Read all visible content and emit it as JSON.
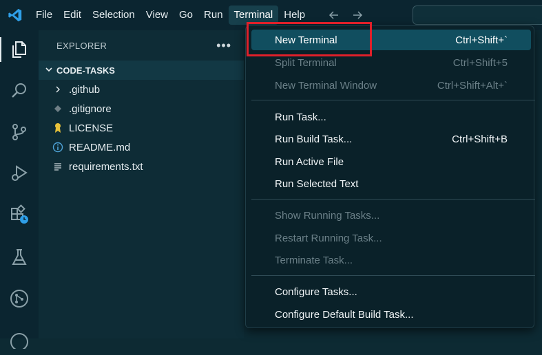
{
  "menubar": {
    "items": [
      {
        "label": "File"
      },
      {
        "label": "Edit"
      },
      {
        "label": "Selection"
      },
      {
        "label": "View"
      },
      {
        "label": "Go"
      },
      {
        "label": "Run"
      },
      {
        "label": "Terminal"
      },
      {
        "label": "Help"
      }
    ],
    "active": "Terminal"
  },
  "sidebar": {
    "title": "EXPLORER",
    "more": "•••",
    "folder": {
      "name": "CODE-TASKS",
      "expanded": true
    },
    "files": [
      {
        "name": ".github",
        "icon": "chevron-right-icon"
      },
      {
        "name": ".gitignore",
        "icon": "git-icon"
      },
      {
        "name": "LICENSE",
        "icon": "license-icon"
      },
      {
        "name": "README.md",
        "icon": "info-icon"
      },
      {
        "name": "requirements.txt",
        "icon": "text-file-icon"
      }
    ]
  },
  "terminal_menu": {
    "groups": [
      [
        {
          "label": "New Terminal",
          "shortcut": "Ctrl+Shift+`",
          "enabled": true,
          "highlighted": true
        },
        {
          "label": "Split Terminal",
          "shortcut": "Ctrl+Shift+5",
          "enabled": false
        },
        {
          "label": "New Terminal Window",
          "shortcut": "Ctrl+Shift+Alt+`",
          "enabled": false
        }
      ],
      [
        {
          "label": "Run Task...",
          "shortcut": "",
          "enabled": true
        },
        {
          "label": "Run Build Task...",
          "shortcut": "Ctrl+Shift+B",
          "enabled": true
        },
        {
          "label": "Run Active File",
          "shortcut": "",
          "enabled": true
        },
        {
          "label": "Run Selected Text",
          "shortcut": "",
          "enabled": true
        }
      ],
      [
        {
          "label": "Show Running Tasks...",
          "shortcut": "",
          "enabled": false
        },
        {
          "label": "Restart Running Task...",
          "shortcut": "",
          "enabled": false
        },
        {
          "label": "Terminate Task...",
          "shortcut": "",
          "enabled": false
        }
      ],
      [
        {
          "label": "Configure Tasks...",
          "shortcut": "",
          "enabled": true
        },
        {
          "label": "Configure Default Build Task...",
          "shortcut": "",
          "enabled": true
        }
      ]
    ]
  },
  "colors": {
    "accent": "#114e5f",
    "annotation": "#e0202a",
    "logo": "#2f9fe8"
  }
}
